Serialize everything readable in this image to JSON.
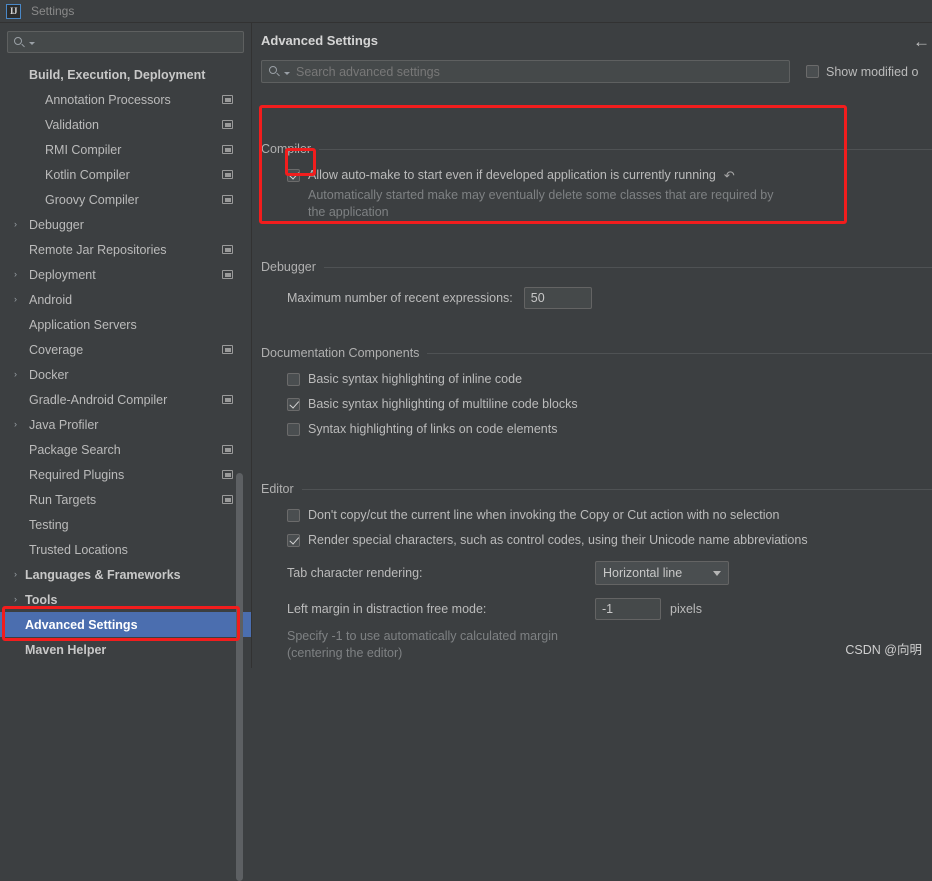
{
  "window": {
    "title": "Settings",
    "logo_text": "IJ"
  },
  "sidebar": {
    "search_placeholder": "",
    "items": [
      {
        "label": "Build, Execution, Deployment",
        "indent": 1,
        "arrow": "",
        "group": true,
        "badge": false,
        "selected": false
      },
      {
        "label": "Annotation Processors",
        "indent": 2,
        "arrow": "",
        "group": false,
        "badge": true,
        "selected": false
      },
      {
        "label": "Validation",
        "indent": 2,
        "arrow": "",
        "group": false,
        "badge": true,
        "selected": false
      },
      {
        "label": "RMI Compiler",
        "indent": 2,
        "arrow": "",
        "group": false,
        "badge": true,
        "selected": false
      },
      {
        "label": "Kotlin Compiler",
        "indent": 2,
        "arrow": "",
        "group": false,
        "badge": true,
        "selected": false
      },
      {
        "label": "Groovy Compiler",
        "indent": 2,
        "arrow": "",
        "group": false,
        "badge": true,
        "selected": false
      },
      {
        "label": "Debugger",
        "indent": 1,
        "arrow": "›",
        "group": false,
        "badge": false,
        "selected": false
      },
      {
        "label": "Remote Jar Repositories",
        "indent": 1,
        "arrow": "",
        "group": false,
        "badge": true,
        "selected": false
      },
      {
        "label": "Deployment",
        "indent": 1,
        "arrow": "›",
        "group": false,
        "badge": true,
        "selected": false
      },
      {
        "label": "Android",
        "indent": 1,
        "arrow": "›",
        "group": false,
        "badge": false,
        "selected": false
      },
      {
        "label": "Application Servers",
        "indent": 1,
        "arrow": "",
        "group": false,
        "badge": false,
        "selected": false
      },
      {
        "label": "Coverage",
        "indent": 1,
        "arrow": "",
        "group": false,
        "badge": true,
        "selected": false
      },
      {
        "label": "Docker",
        "indent": 1,
        "arrow": "›",
        "group": false,
        "badge": false,
        "selected": false
      },
      {
        "label": "Gradle-Android Compiler",
        "indent": 1,
        "arrow": "",
        "group": false,
        "badge": true,
        "selected": false
      },
      {
        "label": "Java Profiler",
        "indent": 1,
        "arrow": "›",
        "group": false,
        "badge": false,
        "selected": false
      },
      {
        "label": "Package Search",
        "indent": 1,
        "arrow": "",
        "group": false,
        "badge": true,
        "selected": false
      },
      {
        "label": "Required Plugins",
        "indent": 1,
        "arrow": "",
        "group": false,
        "badge": true,
        "selected": false
      },
      {
        "label": "Run Targets",
        "indent": 1,
        "arrow": "",
        "group": false,
        "badge": true,
        "selected": false
      },
      {
        "label": "Testing",
        "indent": 1,
        "arrow": "",
        "group": false,
        "badge": false,
        "selected": false
      },
      {
        "label": "Trusted Locations",
        "indent": 1,
        "arrow": "",
        "group": false,
        "badge": false,
        "selected": false
      },
      {
        "label": "Languages & Frameworks",
        "indent": 0,
        "arrow": "›",
        "group": true,
        "badge": false,
        "selected": false
      },
      {
        "label": "Tools",
        "indent": 0,
        "arrow": "›",
        "group": true,
        "badge": false,
        "selected": false
      },
      {
        "label": "Advanced Settings",
        "indent": 0,
        "arrow": "",
        "group": true,
        "badge": false,
        "selected": true
      },
      {
        "label": "Maven Helper",
        "indent": 0,
        "arrow": "",
        "group": true,
        "badge": false,
        "selected": false
      }
    ]
  },
  "main": {
    "title": "Advanced Settings",
    "back_arrow": "←",
    "search_placeholder": "Search advanced settings",
    "show_modified_label": "Show modified o",
    "show_modified_checked": false,
    "sections": {
      "compiler": {
        "title": "Compiler",
        "option_label": "Allow auto-make to start even if developed application is currently running",
        "option_checked": true,
        "revert_icon": "↶",
        "hint": "Automatically started make may eventually delete some classes that are required by the application"
      },
      "debugger": {
        "title": "Debugger",
        "field_label": "Maximum number of recent expressions:",
        "field_value": "50"
      },
      "documentation": {
        "title": "Documentation Components",
        "options": [
          {
            "label": "Basic syntax highlighting of inline code",
            "checked": false
          },
          {
            "label": "Basic syntax highlighting of multiline code blocks",
            "checked": true
          },
          {
            "label": "Syntax highlighting of links on code elements",
            "checked": false
          }
        ]
      },
      "editor": {
        "title": "Editor",
        "options": [
          {
            "label": "Don't copy/cut the current line when invoking the Copy or Cut action with no selection",
            "checked": false
          },
          {
            "label": "Render special characters, such as control codes, using their Unicode name abbreviations",
            "checked": true
          }
        ],
        "tab_rendering_label": "Tab character rendering:",
        "tab_rendering_value": "Horizontal line",
        "left_margin_label": "Left margin in distraction free mode:",
        "left_margin_value": "-1",
        "left_margin_unit": "pixels",
        "left_margin_hint": "Specify -1 to use automatically calculated margin (centering the editor)"
      }
    }
  },
  "watermark": "CSDN @向明",
  "colors": {
    "accent_selection": "#4b6eaf",
    "annotation_red": "#f21d1d",
    "panel_bg": "#3c3f41",
    "input_bg": "#45494a"
  }
}
